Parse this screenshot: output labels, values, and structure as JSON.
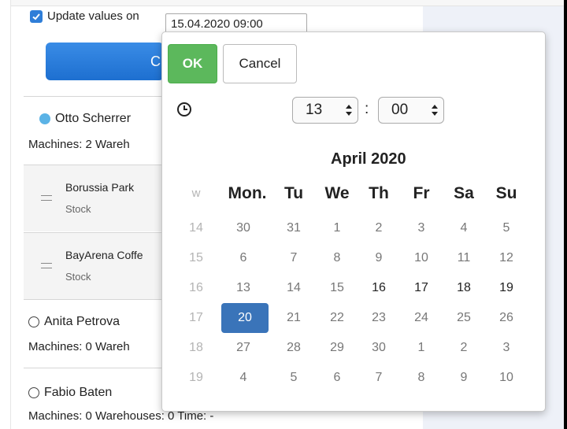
{
  "toolbar": {
    "update_label": "Update values on",
    "date_value": "15.04.2020 09:00",
    "big_button_label": "C"
  },
  "list": [
    {
      "type": "person",
      "name": "Otto Scherrer",
      "status": "active",
      "meta": "Machines: 2 Wareh"
    },
    {
      "type": "sub",
      "title": "Borussia Park",
      "meta": "Stock"
    },
    {
      "type": "sub",
      "title": "BayArena Coffe",
      "meta": "Stock"
    },
    {
      "type": "person",
      "name": "Anita Petrova",
      "status": "inactive",
      "meta": "Machines: 0 Wareh"
    },
    {
      "type": "person",
      "name": "Fabio Baten",
      "status": "inactive",
      "meta": "Machines: 0 Warehouses: 0 Time: -"
    }
  ],
  "picker": {
    "ok_label": "OK",
    "cancel_label": "Cancel",
    "hour": "13",
    "minute": "00",
    "colon": ":",
    "month_title": "April 2020",
    "week_header": "w",
    "day_headers": [
      "Mon.",
      "Tu",
      "We",
      "Th",
      "Fr",
      "Sa",
      "Su"
    ],
    "weeks": [
      {
        "wk": "14",
        "days": [
          "30",
          "31",
          "1",
          "2",
          "3",
          "4",
          "5"
        ]
      },
      {
        "wk": "15",
        "days": [
          "6",
          "7",
          "8",
          "9",
          "10",
          "11",
          "12"
        ]
      },
      {
        "wk": "16",
        "days": [
          "13",
          "14",
          "15",
          "16",
          "17",
          "18",
          "19"
        ]
      },
      {
        "wk": "17",
        "days": [
          "20",
          "21",
          "22",
          "23",
          "24",
          "25",
          "26"
        ]
      },
      {
        "wk": "18",
        "days": [
          "27",
          "28",
          "29",
          "30",
          "1",
          "2",
          "3"
        ]
      },
      {
        "wk": "19",
        "days": [
          "4",
          "5",
          "6",
          "7",
          "8",
          "9",
          "10"
        ]
      }
    ],
    "selected_day": "20"
  },
  "colors": {
    "accent": "#2f7ed8",
    "ok_green": "#5cb85c",
    "selected": "#3a74b9",
    "online_dot": "#5bb3e6"
  }
}
